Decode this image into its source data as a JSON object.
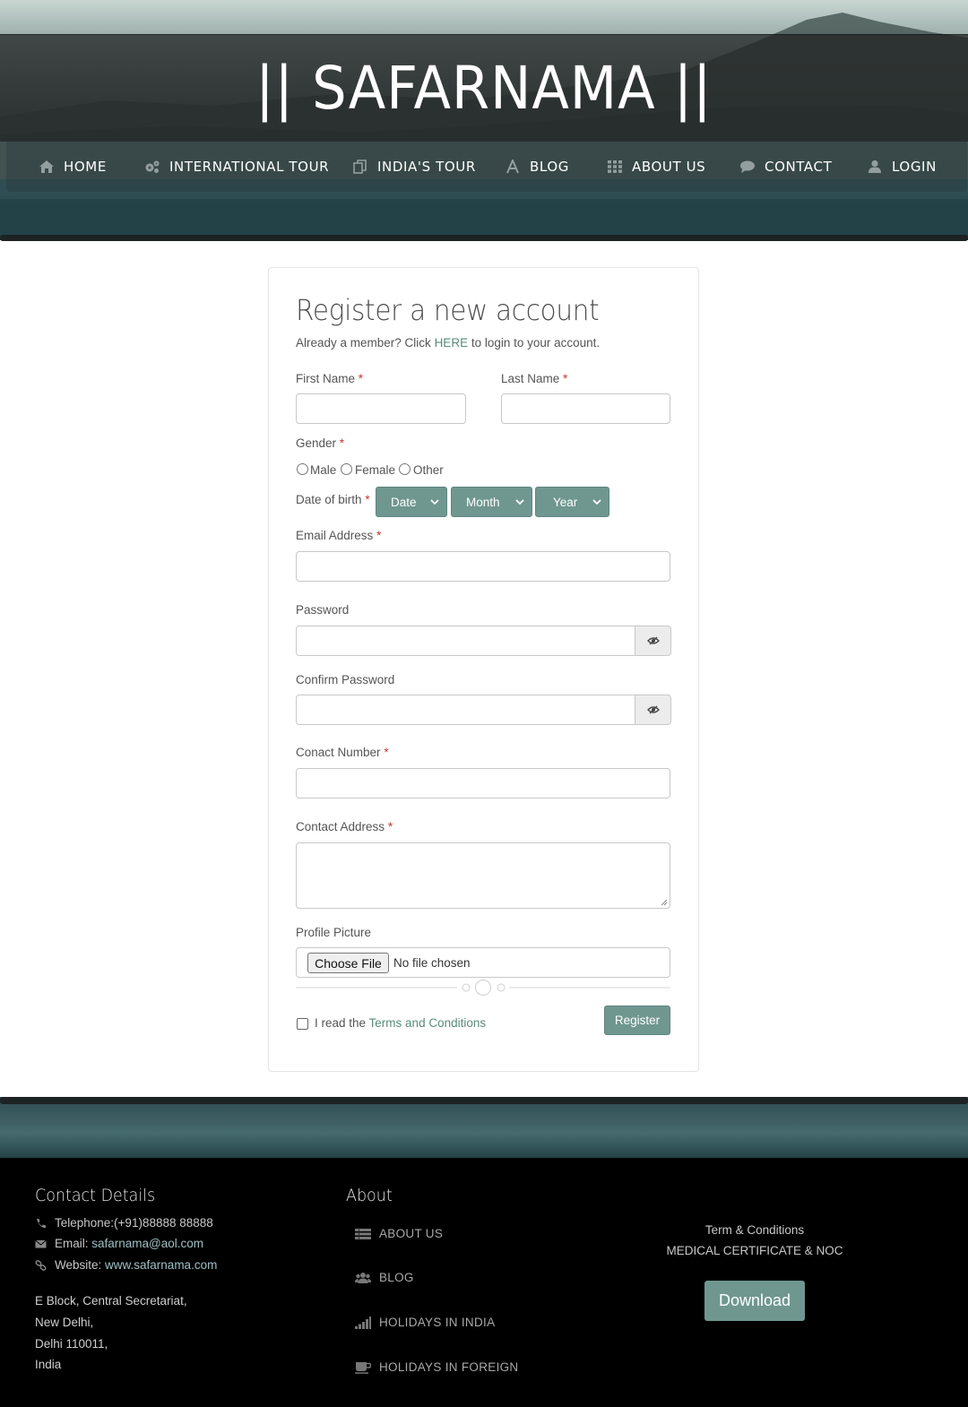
{
  "header": {
    "site_title": "|| SAFARNAMA ||",
    "nav": [
      {
        "label": "HOME",
        "icon": "home-icon"
      },
      {
        "label": "INTERNATIONAL TOUR",
        "icon": "gears-icon"
      },
      {
        "label": "INDIA'S TOUR",
        "icon": "copy-icon"
      },
      {
        "label": "BLOG",
        "icon": "font-icon"
      },
      {
        "label": "ABOUT US",
        "icon": "grid-icon"
      },
      {
        "label": "CONTACT",
        "icon": "comment-icon"
      },
      {
        "label": "LOGIN",
        "icon": "user-icon"
      }
    ]
  },
  "form": {
    "title": "Register a new account",
    "member_prefix": "Already a member? Click ",
    "member_link": "HERE",
    "member_suffix": " to login to your account.",
    "first_name_label": "First Name",
    "last_name_label": "Last Name",
    "gender_label": "Gender",
    "gender_options": [
      "Male",
      "Female",
      "Other"
    ],
    "dob_label": "Date of birth",
    "dob_selects": [
      "Date",
      "Month",
      "Year"
    ],
    "email_label": "Email Address",
    "password_label": "Password",
    "confirm_password_label": "Confirm Password",
    "contact_number_label": "Conact Number",
    "contact_address_label": "Contact Address",
    "profile_picture_label": "Profile Picture",
    "choose_file_label": "Choose File",
    "file_status": "No file chosen",
    "required_mark": "*",
    "terms_prefix": "I read the ",
    "terms_link": "Terms and Conditions",
    "register_label": "Register"
  },
  "footer": {
    "contact_heading": "Contact Details",
    "telephone": "Telephone:(+91)88888 88888",
    "email_prefix": "Email: ",
    "email": "safarnama@aol.com",
    "website_prefix": "Website: ",
    "website": "www.safarnama.com",
    "address": [
      "E Block, Central Secretariat,",
      "New Delhi,",
      "Delhi 110011,",
      "India"
    ],
    "about_heading": "About",
    "about_links": [
      {
        "label": "ABOUT US",
        "icon": "list-icon"
      },
      {
        "label": "BLOG",
        "icon": "users-icon"
      },
      {
        "label": "HOLIDAYS IN INDIA",
        "icon": "signal-icon"
      },
      {
        "label": "HOLIDAYS IN FOREIGN",
        "icon": "coffee-icon"
      }
    ],
    "terms_text": "Term & Conditions",
    "medical_text": "MEDICAL CERTIFICATE & NOC",
    "download_label": "Download"
  },
  "colors": {
    "accent": "#6f9790",
    "link": "#5a8a7a",
    "required": "#c0392b",
    "footer_bg": "#000000"
  }
}
